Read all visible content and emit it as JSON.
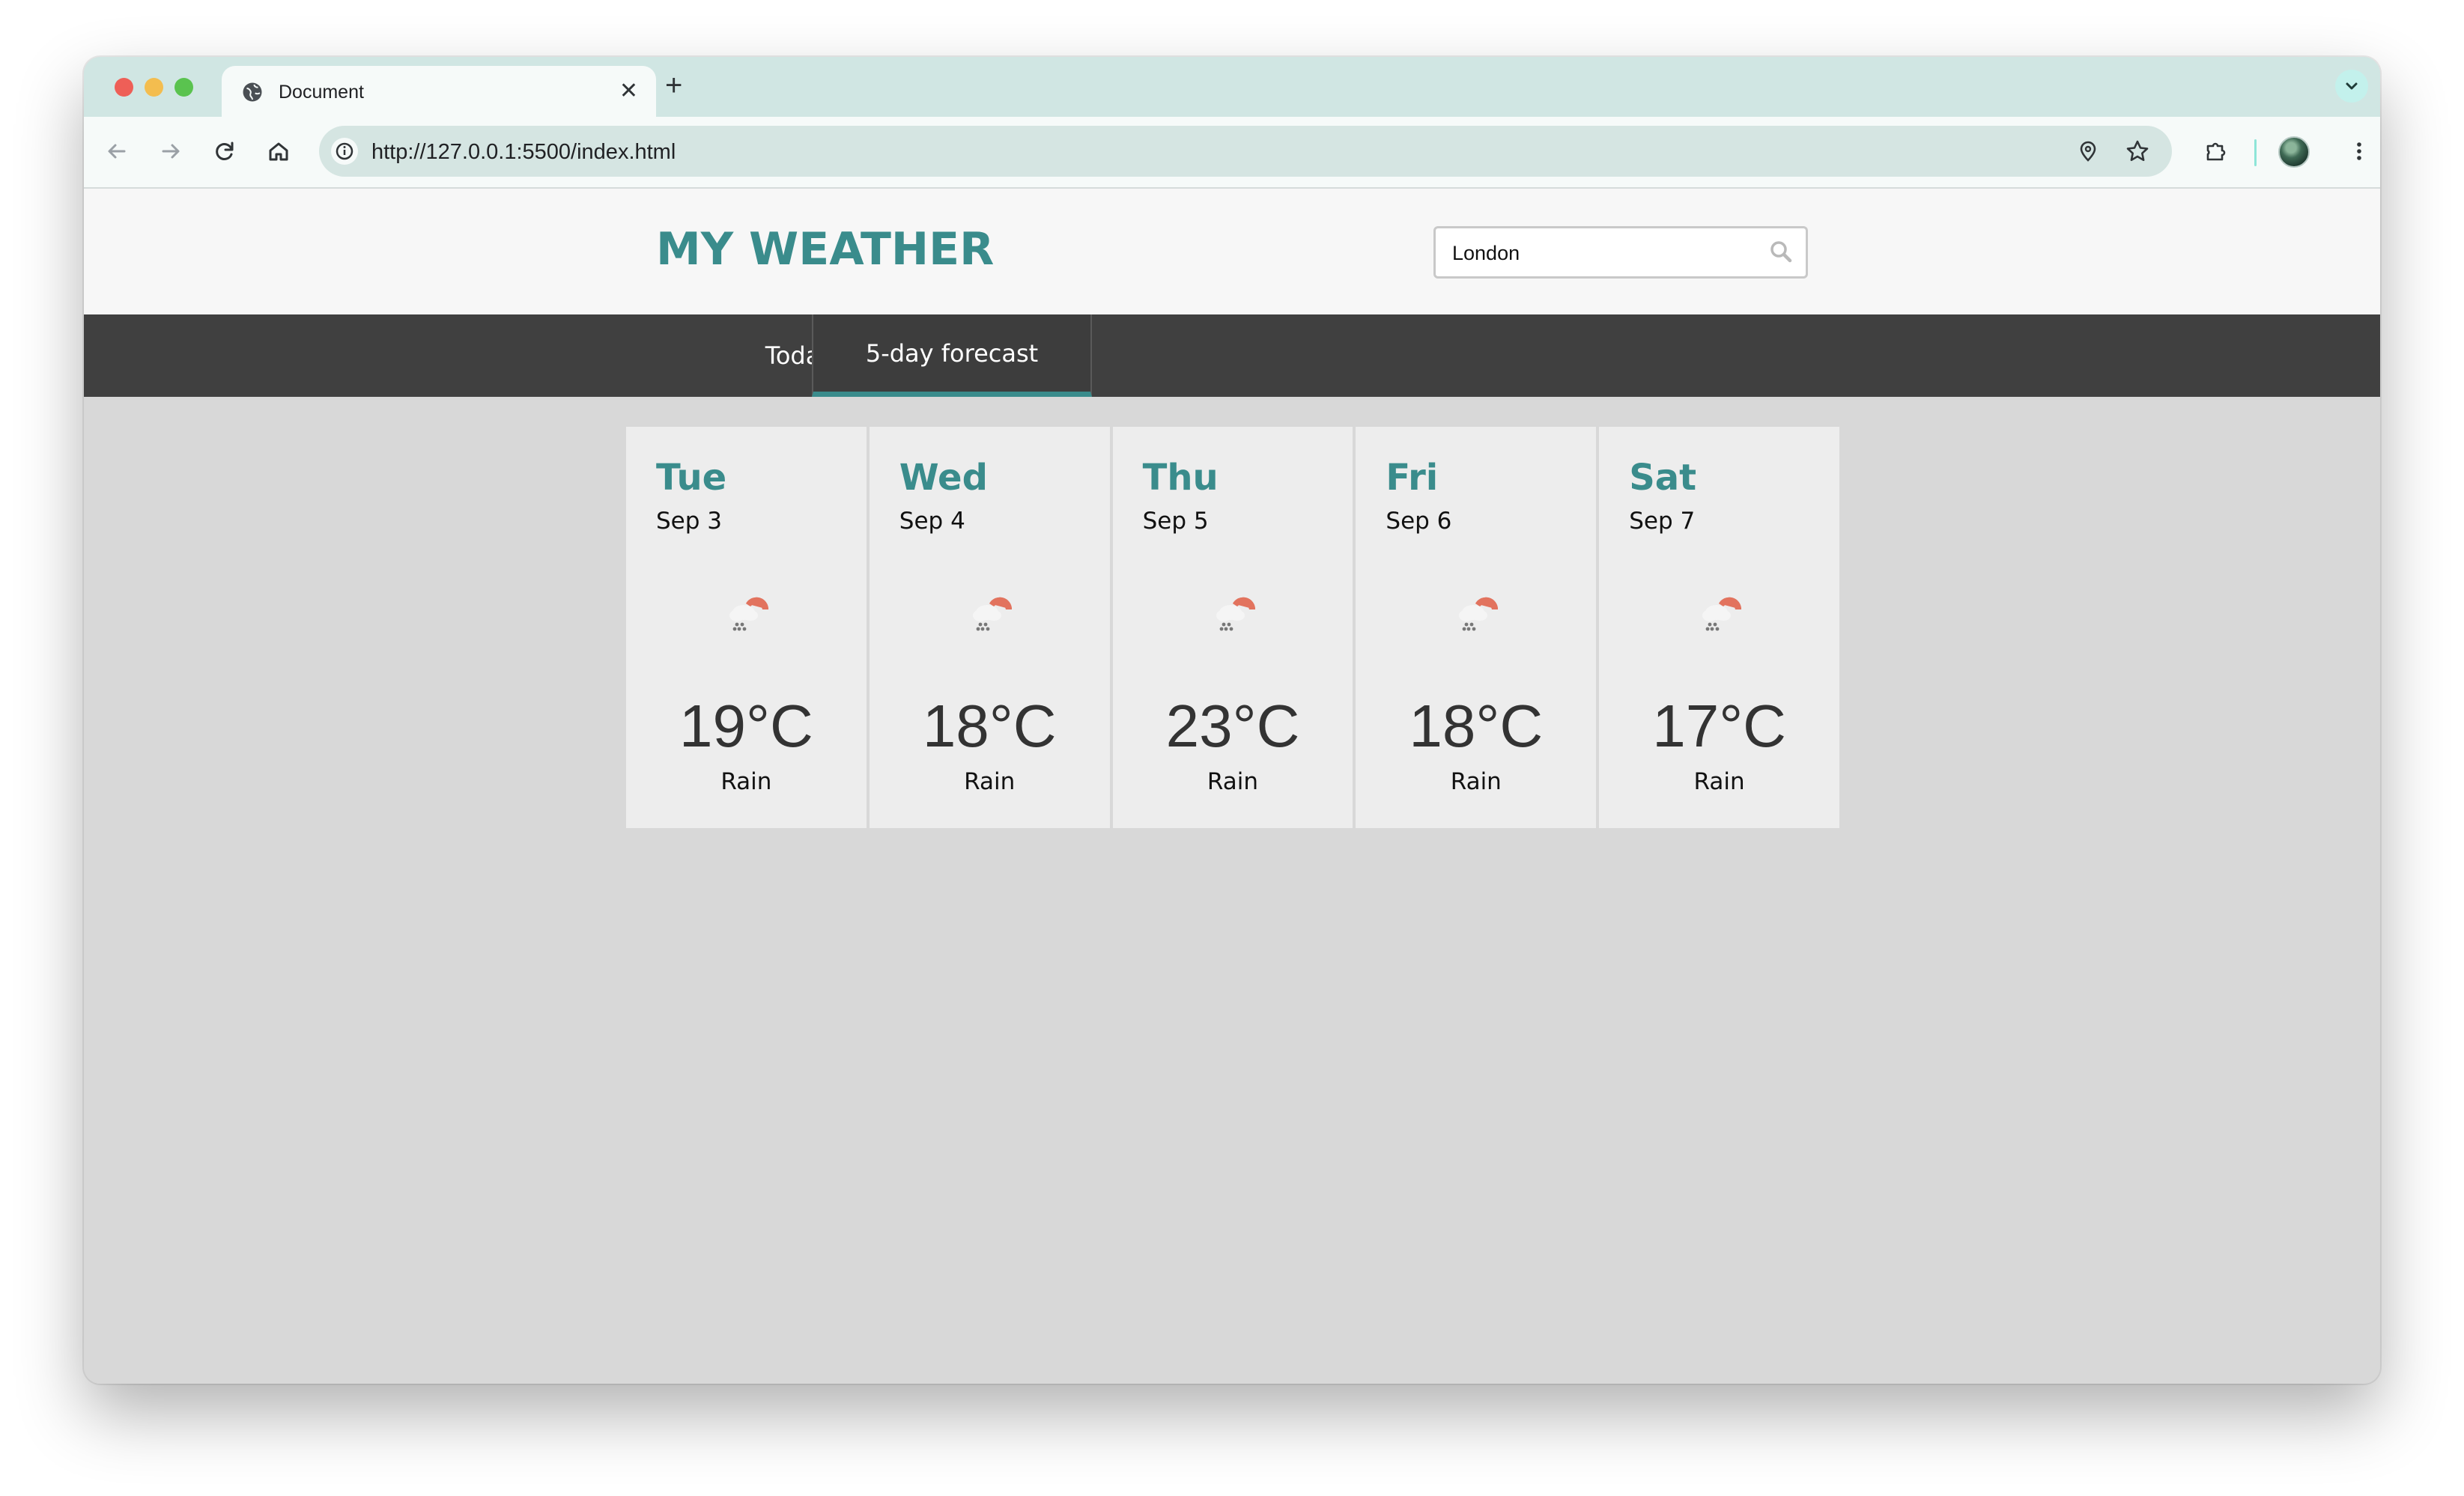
{
  "browser": {
    "tab_title": "Document",
    "url": "http://127.0.0.1:5500/index.html",
    "icons": [
      "back-icon",
      "forward-icon",
      "reload-icon",
      "home-icon",
      "info-icon",
      "location-pin-icon",
      "bookmark-star-icon",
      "extensions-icon",
      "menu-dots-icon"
    ],
    "accent": "#d0e6e3"
  },
  "site": {
    "brand": "MY WEATHER",
    "search_value": "London",
    "brand_color": "#3a8c8c"
  },
  "nav": {
    "tabs": [
      {
        "label": "Today"
      },
      {
        "label": "5-day forecast"
      }
    ],
    "active": "5-day forecast"
  },
  "forecast": [
    {
      "day": "Tue",
      "date": "Sep 3",
      "temp": "19°C",
      "desc": "Rain",
      "icon": "rain-cloud-sun-icon"
    },
    {
      "day": "Wed",
      "date": "Sep 4",
      "temp": "18°C",
      "desc": "Rain",
      "icon": "rain-cloud-sun-icon"
    },
    {
      "day": "Thu",
      "date": "Sep 5",
      "temp": "23°C",
      "desc": "Rain",
      "icon": "rain-cloud-sun-icon"
    },
    {
      "day": "Fri",
      "date": "Sep 6",
      "temp": "18°C",
      "desc": "Rain",
      "icon": "rain-cloud-sun-icon"
    },
    {
      "day": "Sat",
      "date": "Sep 7",
      "temp": "17°C",
      "desc": "Rain",
      "icon": "rain-cloud-sun-icon"
    }
  ]
}
